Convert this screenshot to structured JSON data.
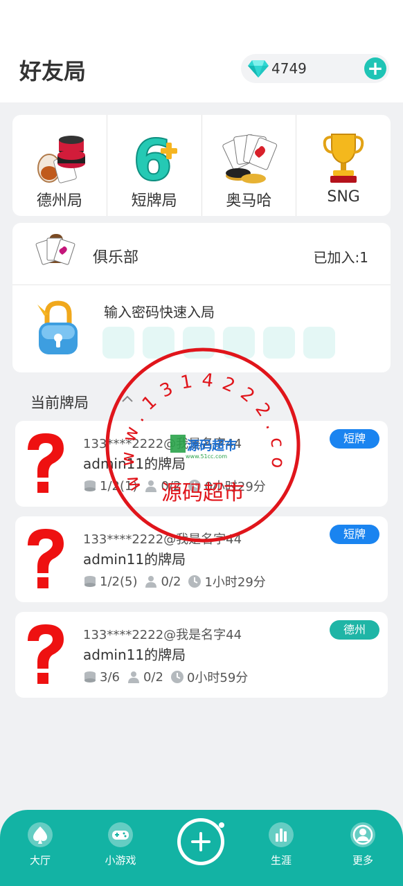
{
  "header": {
    "title": "好友局",
    "gems": "4749"
  },
  "game_types": [
    {
      "label": "德州局",
      "icon": "poker-chips-icon"
    },
    {
      "label": "短牌局",
      "icon": "six-plus-icon"
    },
    {
      "label": "奥马哈",
      "icon": "playing-cards-icon"
    },
    {
      "label": "SNG",
      "icon": "trophy-icon"
    }
  ],
  "club": {
    "label": "俱乐部",
    "joined": "已加入:1"
  },
  "password": {
    "label": "输入密码快速入局",
    "slots": 6
  },
  "current": {
    "title": "当前牌局"
  },
  "rooms": [
    {
      "owner": "133****2222@我是名字44",
      "name": "admin11的牌局",
      "blinds": "1/2(1)",
      "players": "0/2",
      "time": "0小时29分",
      "tag": "短牌",
      "tag_color": "#1a84f0"
    },
    {
      "owner": "133****2222@我是名字44",
      "name": "admin11的牌局",
      "blinds": "1/2(5)",
      "players": "0/2",
      "time": "1小时29分",
      "tag": "短牌",
      "tag_color": "#1a84f0"
    },
    {
      "owner": "133****2222@我是名字44",
      "name": "admin11的牌局",
      "blinds": "3/6",
      "players": "0/2",
      "time": "0小时59分",
      "tag": "德州",
      "tag_color": "#1fb5a6"
    }
  ],
  "watermark": {
    "ring": "www.1314222.com",
    "center": "源码超市",
    "logo": "源码超市",
    "logo_url": "www.51cc.com"
  },
  "tabs": [
    {
      "label": "大厅",
      "icon": "spade-icon"
    },
    {
      "label": "小游戏",
      "icon": "gamepad-icon"
    },
    {
      "label": "生涯",
      "icon": "bar-chart-icon"
    },
    {
      "label": "更多",
      "icon": "user-icon"
    }
  ],
  "colors": {
    "accent": "#13b3a4",
    "tag_blue": "#1a84f0",
    "tag_teal": "#1fb5a6",
    "stamp_red": "#e0151b"
  }
}
